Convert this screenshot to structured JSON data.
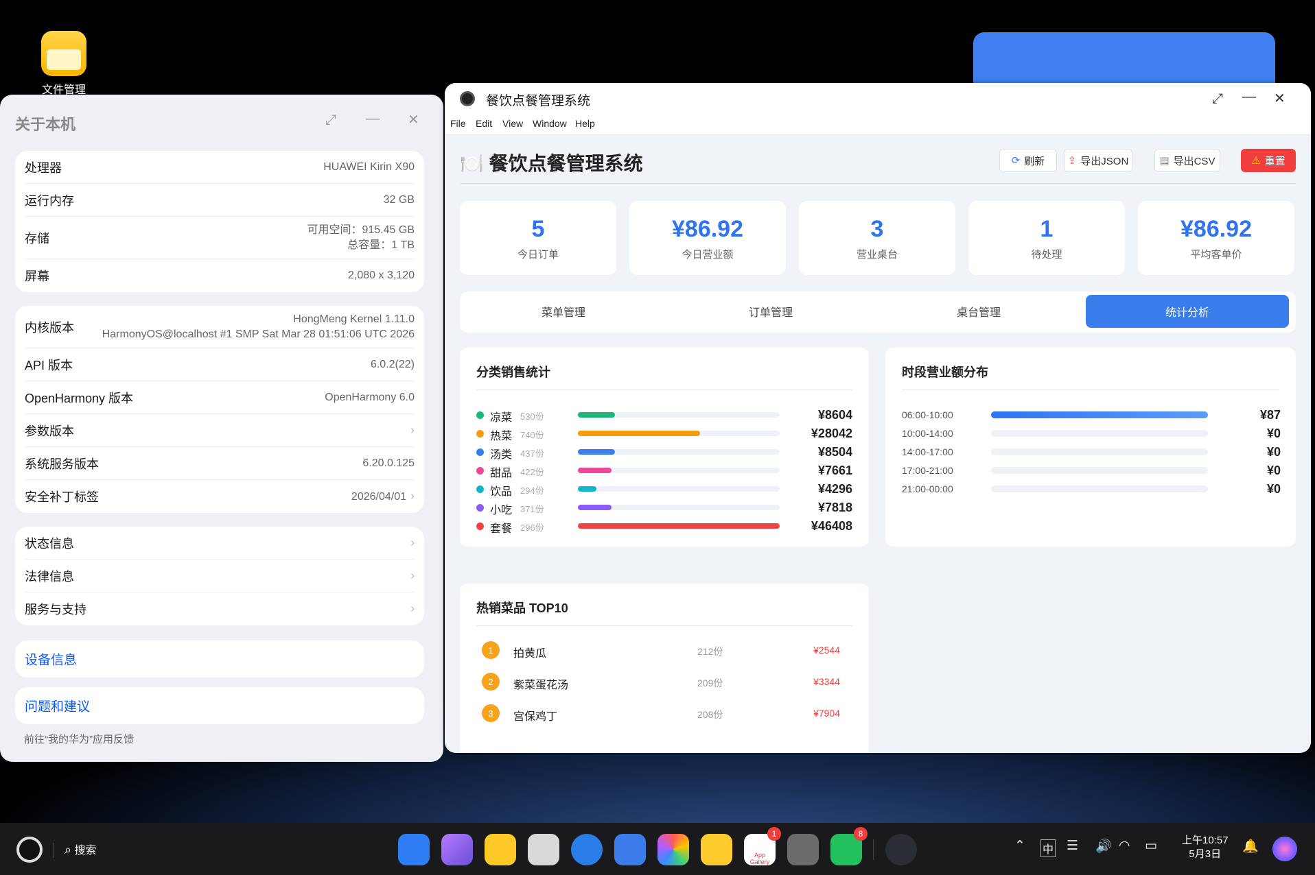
{
  "desktop": {
    "file_manager_label": "文件管理"
  },
  "about": {
    "title": "关于本机",
    "hardware": [
      {
        "key": "处理器",
        "value": "HUAWEI Kirin X90"
      },
      {
        "key": "运行内存",
        "value": "32 GB"
      },
      {
        "key": "存储",
        "value": "可用空间：915.45 GB",
        "value2": "总容量：1 TB"
      },
      {
        "key": "屏幕",
        "value": "2,080 x 3,120"
      }
    ],
    "software": [
      {
        "key": "内核版本",
        "value": "HongMeng Kernel 1.11.0",
        "value2": "HarmonyOS@localhost #1 SMP Sat Mar 28 01:51:06 UTC 2026"
      },
      {
        "key": "API 版本",
        "value": "6.0.2(22)"
      },
      {
        "key": "OpenHarmony 版本",
        "value": "OpenHarmony 6.0"
      },
      {
        "key": "参数版本",
        "value": ""
      },
      {
        "key": "系统服务版本",
        "value": "6.20.0.125"
      },
      {
        "key": "安全补丁标签",
        "value": "2026/04/01"
      }
    ],
    "info": [
      {
        "key": "状态信息"
      },
      {
        "key": "法律信息"
      },
      {
        "key": "服务与支持"
      }
    ],
    "device_info": "设备信息",
    "feedback": "问题和建议",
    "feedback_hint": "前往“我的华为”应用反馈"
  },
  "main": {
    "window_title": "餐饮点餐管理系统",
    "menu": [
      "File",
      "Edit",
      "View",
      "Window",
      "Help"
    ],
    "header_title": "🍽️ 餐饮点餐管理系统",
    "buttons": {
      "refresh": "刷新",
      "export_json": "导出JSON",
      "export_csv": "导出CSV",
      "reset": "重置"
    },
    "stats": [
      {
        "value": "5",
        "label": "今日订单"
      },
      {
        "value": "¥86.92",
        "label": "今日营业额"
      },
      {
        "value": "3",
        "label": "营业桌台"
      },
      {
        "value": "1",
        "label": "待处理"
      },
      {
        "value": "¥86.92",
        "label": "平均客单价"
      }
    ],
    "tabs": [
      "菜单管理",
      "订单管理",
      "桌台管理",
      "统计分析"
    ],
    "active_tab": "统计分析",
    "category_title": "分类销售统计",
    "categories": [
      {
        "name": "凉菜",
        "count": "530份",
        "amount": "¥8604",
        "ratio": 0.185,
        "color": "#1ab67a"
      },
      {
        "name": "热菜",
        "count": "740份",
        "amount": "¥28042",
        "ratio": 0.605,
        "color": "#f39c12"
      },
      {
        "name": "汤类",
        "count": "437份",
        "amount": "¥8504",
        "ratio": 0.183,
        "color": "#3a7eee"
      },
      {
        "name": "甜品",
        "count": "422份",
        "amount": "¥7661",
        "ratio": 0.165,
        "color": "#ec4899"
      },
      {
        "name": "饮品",
        "count": "294份",
        "amount": "¥4296",
        "ratio": 0.093,
        "color": "#13b5c8"
      },
      {
        "name": "小吃",
        "count": "371份",
        "amount": "¥7818",
        "ratio": 0.168,
        "color": "#8b5cf6"
      },
      {
        "name": "套餐",
        "count": "296份",
        "amount": "¥46408",
        "ratio": 1.0,
        "color": "#ef4444"
      }
    ],
    "time_title": "时段营业额分布",
    "time_slots": [
      {
        "label": "06:00-10:00",
        "amount": "¥87",
        "ratio": 1.0
      },
      {
        "label": "10:00-14:00",
        "amount": "¥0",
        "ratio": 0
      },
      {
        "label": "14:00-17:00",
        "amount": "¥0",
        "ratio": 0
      },
      {
        "label": "17:00-21:00",
        "amount": "¥0",
        "ratio": 0
      },
      {
        "label": "21:00-00:00",
        "amount": "¥0",
        "ratio": 0
      }
    ],
    "top_title": "热销菜品 TOP10",
    "top_items": [
      {
        "rank": "1",
        "name": "拍黄瓜",
        "count": "212份",
        "revenue": "¥2544"
      },
      {
        "rank": "2",
        "name": "紫菜蛋花汤",
        "count": "209份",
        "revenue": "¥3344"
      },
      {
        "rank": "3",
        "name": "宫保鸡丁",
        "count": "208份",
        "revenue": "¥7904"
      }
    ]
  },
  "taskbar": {
    "search": "搜索",
    "ime": "中",
    "time": "上午10:57",
    "date": "5月3日",
    "app_gallery_badge": "1",
    "wechat_badge": "8",
    "app_gallery_label": "App Gallery"
  }
}
